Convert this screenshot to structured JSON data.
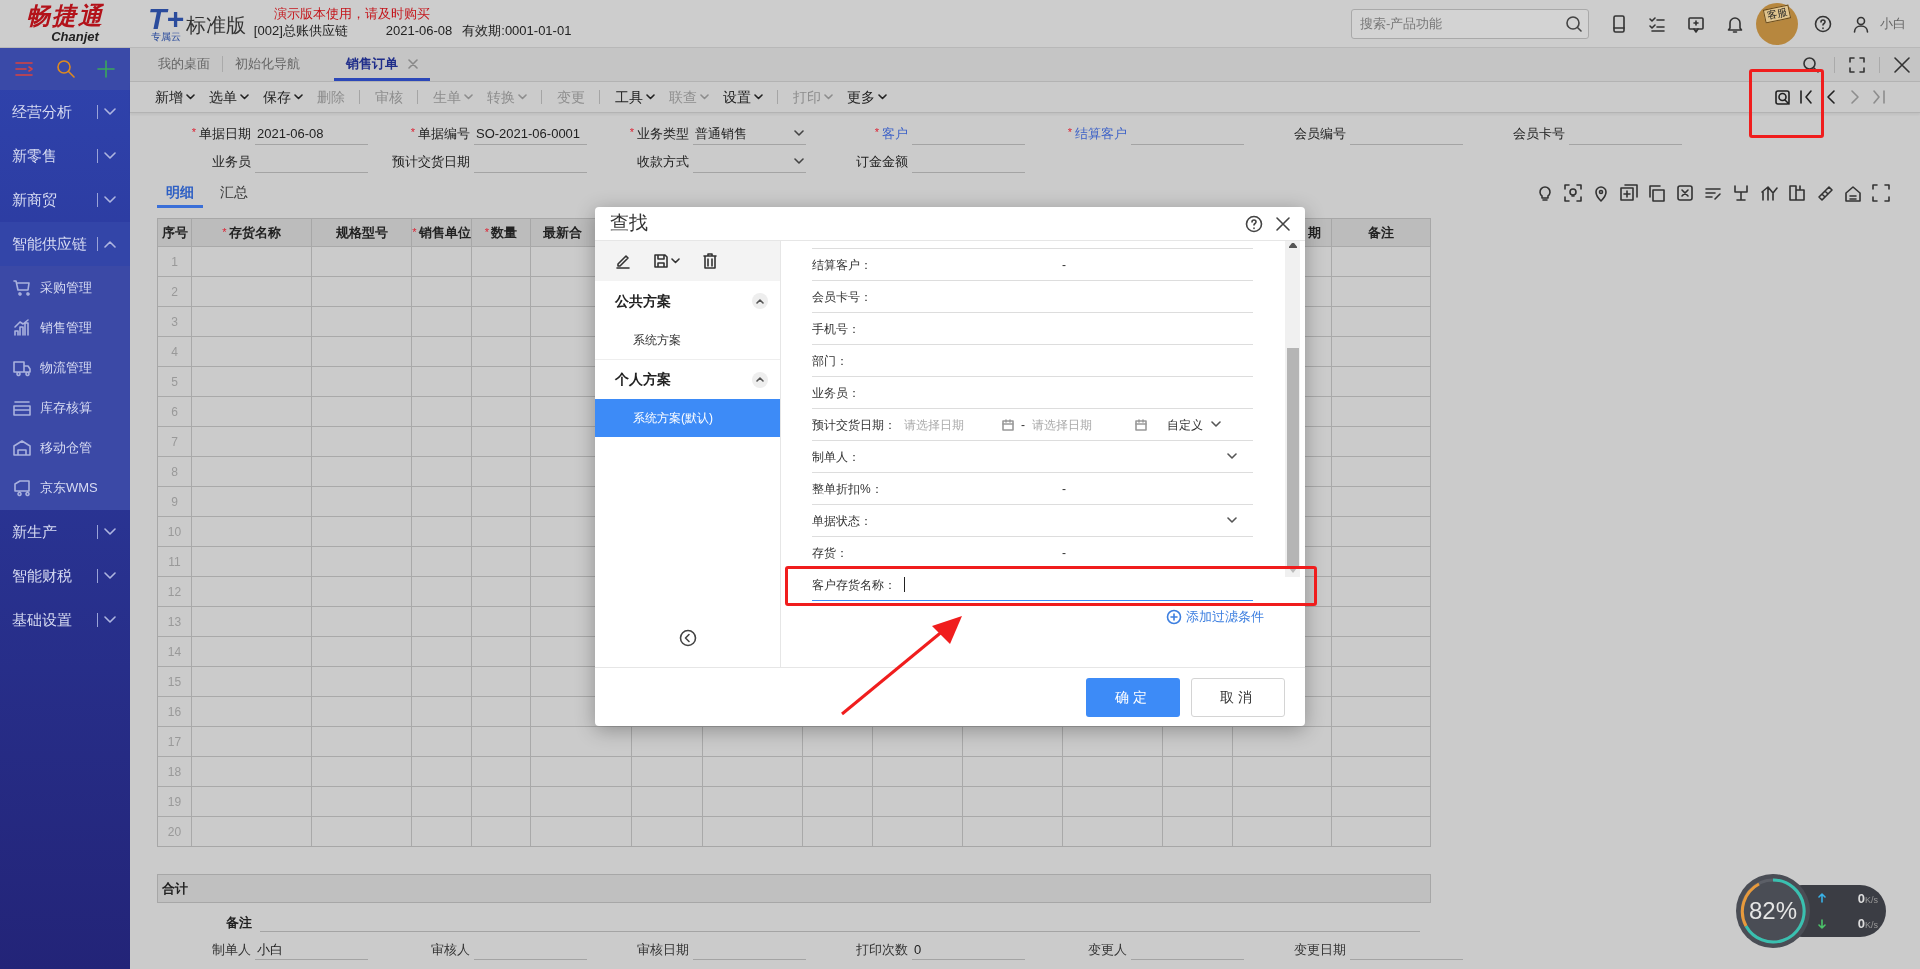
{
  "header": {
    "logo_cn": "畅捷通",
    "logo_en": "Chanjet",
    "product_logo": "T+",
    "product_sub": "专属云",
    "product": "标准版",
    "notice": "演示版本使用，请及时购买",
    "account": "[002]总账供应链",
    "date": "2021-06-08",
    "validity": "有效期:0001-01-01",
    "search": {
      "placeholder": "搜索-产品功能"
    },
    "mascot_badge": "客服",
    "user": "小白"
  },
  "sidebar": {
    "items": [
      {
        "label": "经营分析",
        "expanded": false
      },
      {
        "label": "新零售",
        "expanded": false
      },
      {
        "label": "新商贸",
        "expanded": false
      },
      {
        "label": "智能供应链",
        "expanded": true,
        "children": [
          {
            "label": "采购管理",
            "kind": "cart"
          },
          {
            "label": "销售管理",
            "kind": "chart"
          },
          {
            "label": "物流管理",
            "kind": "truck"
          },
          {
            "label": "库存核算",
            "kind": "stack"
          },
          {
            "label": "移动仓管",
            "kind": "warehouse"
          },
          {
            "label": "京东WMS",
            "kind": "van"
          }
        ]
      },
      {
        "label": "新生产",
        "expanded": false
      },
      {
        "label": "智能财税",
        "expanded": false
      },
      {
        "label": "基础设置",
        "expanded": false
      }
    ]
  },
  "tabs": [
    {
      "label": "我的桌面",
      "selected": false,
      "closable": false
    },
    {
      "label": "初始化导航",
      "selected": false,
      "closable": false
    },
    {
      "label": "销售订单",
      "selected": true,
      "closable": true
    }
  ],
  "toolbar": [
    {
      "label": "新增",
      "dropdown": true,
      "disabled": false,
      "divider_before": false
    },
    {
      "label": "选单",
      "dropdown": true,
      "disabled": false,
      "divider_before": false
    },
    {
      "label": "保存",
      "dropdown": true,
      "disabled": false,
      "divider_before": false
    },
    {
      "label": "删除",
      "dropdown": false,
      "disabled": true,
      "divider_before": false
    },
    {
      "label": "审核",
      "dropdown": false,
      "disabled": true,
      "divider_before": true
    },
    {
      "label": "生单",
      "dropdown": true,
      "disabled": true,
      "divider_before": true
    },
    {
      "label": "转换",
      "dropdown": true,
      "disabled": true,
      "divider_before": false
    },
    {
      "label": "变更",
      "dropdown": false,
      "disabled": true,
      "divider_before": true
    },
    {
      "label": "工具",
      "dropdown": true,
      "disabled": false,
      "divider_before": true
    },
    {
      "label": "联查",
      "dropdown": true,
      "disabled": true,
      "divider_before": false
    },
    {
      "label": "设置",
      "dropdown": true,
      "disabled": false,
      "divider_before": false
    },
    {
      "label": "打印",
      "dropdown": true,
      "disabled": true,
      "divider_before": true
    },
    {
      "label": "更多",
      "dropdown": true,
      "disabled": false,
      "divider_before": false
    }
  ],
  "record_nav": [
    {
      "kind": "find",
      "disabled": false
    },
    {
      "kind": "first",
      "disabled": false
    },
    {
      "kind": "prev",
      "disabled": false
    },
    {
      "kind": "next",
      "disabled": true
    },
    {
      "kind": "last",
      "disabled": true
    }
  ],
  "form": {
    "rows": [
      [
        {
          "required_mark": "*",
          "label": "单据日期",
          "value": "2021-06-08",
          "link": false,
          "select": false
        },
        {
          "required_mark": "*",
          "label": "单据编号",
          "value": "SO-2021-06-0001",
          "link": false,
          "select": false
        },
        {
          "required_mark": "*",
          "label": "业务类型",
          "value": "普通销售",
          "link": false,
          "select": true
        },
        {
          "required_mark": "*",
          "label": "客户",
          "link": true,
          "select": false
        },
        {
          "required_mark": "*",
          "label": "结算客户",
          "link": true,
          "select": false
        },
        {
          "label": "会员编号",
          "link": false,
          "select": false
        },
        {
          "label": "会员卡号",
          "link": false,
          "select": false
        }
      ],
      [
        {
          "label": "业务员",
          "link": false,
          "select": false
        },
        {
          "label": "预计交货日期",
          "link": false,
          "select": false
        },
        {
          "label": "收款方式",
          "link": false,
          "select": true
        },
        {
          "label": "订金金额",
          "link": false,
          "select": false
        }
      ]
    ]
  },
  "detail_tabs": [
    {
      "label": "明细",
      "selected": true
    },
    {
      "label": "汇总",
      "selected": false
    }
  ],
  "table": {
    "columns": [
      {
        "label": "序号"
      },
      {
        "required_mark": "*",
        "label": "存货名称"
      },
      {
        "label": "规格型号"
      },
      {
        "required_mark": "*",
        "label": "销售单位"
      },
      {
        "required_mark": "*",
        "label": "数量"
      },
      {
        "label": "最新合"
      },
      {
        "label": "期"
      },
      {
        "label": "备注"
      }
    ],
    "rows": [
      "1",
      "2",
      "3",
      "4",
      "5",
      "6",
      "7",
      "8",
      "9",
      "10",
      "11",
      "12",
      "13",
      "14",
      "15",
      "16",
      "17",
      "18",
      "19",
      "20"
    ]
  },
  "total_label": "合计",
  "remark_label": "备注",
  "footer_fields": [
    {
      "label": "制单人",
      "value": "小白"
    },
    {
      "label": "审核人"
    },
    {
      "label": "审核日期"
    },
    {
      "label": "打印次数",
      "value": "0"
    },
    {
      "label": "变更人"
    },
    {
      "label": "变更日期"
    }
  ],
  "dialog": {
    "title": "查找",
    "groups": [
      {
        "label": "公共方案",
        "expanded": true,
        "items": [
          {
            "label": "系统方案",
            "selected": false
          }
        ]
      },
      {
        "label": "个人方案",
        "expanded": true,
        "items": [
          {
            "label": "系统方案(默认)",
            "selected": true
          }
        ]
      }
    ],
    "fields": [
      {
        "kind": "range",
        "label": "结算客户：",
        "separator": "-"
      },
      {
        "kind": "text",
        "label": "会员卡号："
      },
      {
        "kind": "text",
        "label": "手机号："
      },
      {
        "kind": "text",
        "label": "部门："
      },
      {
        "kind": "text",
        "label": "业务员："
      },
      {
        "kind": "date_range",
        "label": "预计交货日期：",
        "placeholder_from": "请选择日期",
        "separator": "-",
        "placeholder_to": "请选择日期",
        "mode": "自定义"
      },
      {
        "kind": "select",
        "label": "制单人："
      },
      {
        "kind": "range",
        "label": "整单折扣%：",
        "separator": "-"
      },
      {
        "kind": "select",
        "label": "单据状态："
      },
      {
        "kind": "range",
        "label": "存货：",
        "separator": "-"
      },
      {
        "kind": "input",
        "label": "客户存货名称：",
        "focused": true
      }
    ],
    "add_filter": "添加过滤条件",
    "buttons": [
      {
        "label": "确定",
        "primary": true
      },
      {
        "label": "取消",
        "primary": false
      }
    ]
  },
  "annotations": [
    {
      "kind": "box"
    },
    {
      "kind": "box"
    },
    {
      "kind": "arrow"
    }
  ],
  "speed_widget": {
    "percent": "82%",
    "up": {
      "value": "0",
      "unit": "K/s"
    },
    "down": {
      "value": "0",
      "unit": "K/s"
    }
  }
}
